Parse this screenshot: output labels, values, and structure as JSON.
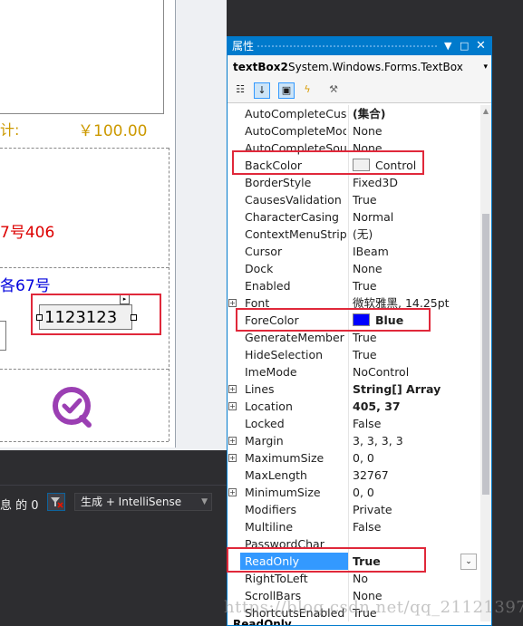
{
  "designer": {
    "price_label": "计:",
    "price_value": "￥100.00",
    "address_line1": "7号406",
    "address_line2": "各67号",
    "textbox_value": "1123123",
    "logo_icon": "check-circle-logo",
    "logo_color": "#9b3fb3"
  },
  "bottom_bar": {
    "message": "息 的 0",
    "build_option": "生成 + IntelliSense"
  },
  "properties": {
    "title": "属性",
    "object_name": "textBox2",
    "object_type": "System.Windows.Forms.TextBox",
    "rows": [
      {
        "name": "AutoCompleteCusto",
        "value": "(集合)",
        "bold": true
      },
      {
        "name": "AutoCompleteMode",
        "value": "None"
      },
      {
        "name": "AutoCompleteSource",
        "value": "None"
      },
      {
        "name": "BackColor",
        "value": "Control",
        "swatch": "#f0f0f0"
      },
      {
        "name": "BorderStyle",
        "value": "Fixed3D"
      },
      {
        "name": "CausesValidation",
        "value": "True"
      },
      {
        "name": "CharacterCasing",
        "value": "Normal"
      },
      {
        "name": "ContextMenuStrip",
        "value": "(无)"
      },
      {
        "name": "Cursor",
        "value": "IBeam"
      },
      {
        "name": "Dock",
        "value": "None"
      },
      {
        "name": "Enabled",
        "value": "True"
      },
      {
        "name": "Font",
        "value": "微软雅黑, 14.25pt",
        "expandable": true
      },
      {
        "name": "ForeColor",
        "value": "Blue",
        "swatch": "#0000ff",
        "bold": true
      },
      {
        "name": "GenerateMember",
        "value": "True"
      },
      {
        "name": "HideSelection",
        "value": "True"
      },
      {
        "name": "ImeMode",
        "value": "NoControl"
      },
      {
        "name": "Lines",
        "value": "String[] Array",
        "bold": true,
        "expandable": true
      },
      {
        "name": "Location",
        "value": "405, 37",
        "bold": true,
        "expandable": true
      },
      {
        "name": "Locked",
        "value": "False"
      },
      {
        "name": "Margin",
        "value": "3, 3, 3, 3",
        "expandable": true
      },
      {
        "name": "MaximumSize",
        "value": "0, 0",
        "expandable": true
      },
      {
        "name": "MaxLength",
        "value": "32767"
      },
      {
        "name": "MinimumSize",
        "value": "0, 0",
        "expandable": true
      },
      {
        "name": "Modifiers",
        "value": "Private"
      },
      {
        "name": "Multiline",
        "value": "False"
      },
      {
        "name": "PasswordChar",
        "value": ""
      },
      {
        "name": "ReadOnly",
        "value": "True",
        "bold": true,
        "selected": true,
        "dropdown": true
      },
      {
        "name": "RightToLeft",
        "value": "No"
      },
      {
        "name": "ScrollBars",
        "value": "None"
      },
      {
        "name": "ShortcutsEnabled",
        "value": "True"
      }
    ],
    "description_title": "ReadOnly"
  },
  "watermark": "https://blog.csdn.net/qq_21121397",
  "colors": {
    "accent": "#007acc",
    "highlight_box": "#e0283a",
    "selection": "#3399ff"
  }
}
